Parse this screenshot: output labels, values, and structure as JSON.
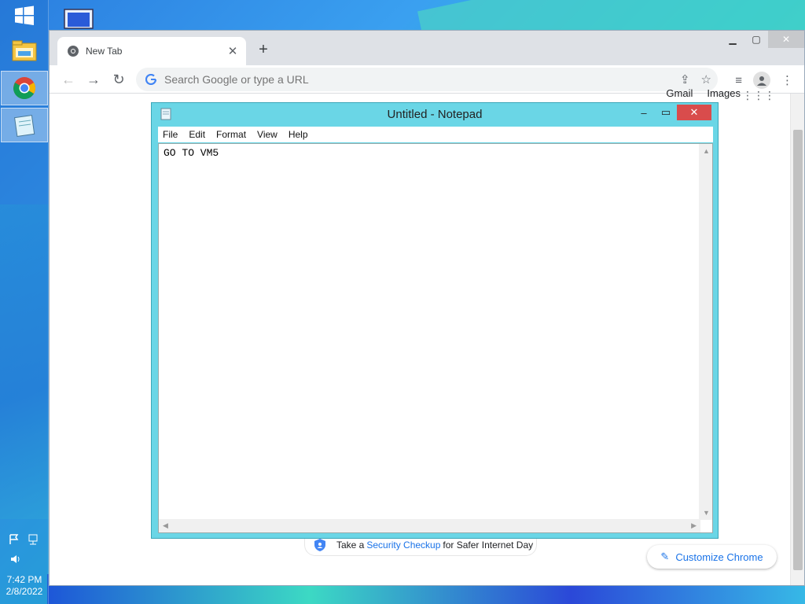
{
  "desktop": {
    "taskbar": {
      "clock_time": "7:42 PM",
      "clock_date": "2/8/2022"
    }
  },
  "chrome": {
    "tab_title": "New Tab",
    "omnibox_placeholder": "Search Google or type a URL",
    "top_links": [
      "Gmail",
      "Images"
    ],
    "security_prefix": "Take a",
    "security_link": "Security Checkup",
    "security_suffix": "for Safer Internet Day",
    "customize_label": "Customize Chrome"
  },
  "notepad": {
    "title": "Untitled - Notepad",
    "menu": [
      "File",
      "Edit",
      "Format",
      "View",
      "Help"
    ],
    "content": "GO TO VM5"
  },
  "colors": {
    "notepad_frame": "#6ad6e6",
    "close_red": "#d94c4c",
    "link_blue": "#1a73e8"
  }
}
